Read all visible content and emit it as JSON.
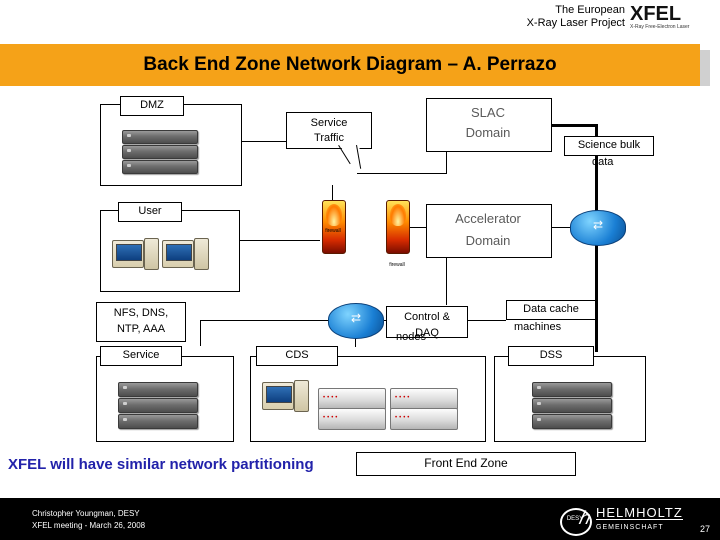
{
  "header": {
    "line1": "The European",
    "line2": "X-Ray Laser Project",
    "logo": "XFEL",
    "logo_sub": "X-Ray Free-Electron Laser"
  },
  "title": "Back End Zone Network Diagram – A. Perrazo",
  "diagram": {
    "boxes": [
      {
        "name": "dmz",
        "label": "DMZ"
      },
      {
        "name": "user",
        "label": "User"
      },
      {
        "name": "nfs-dns-ntp-aaa",
        "label": "NFS, DNS,\nNTP, AAA"
      },
      {
        "name": "service",
        "label": "Service"
      },
      {
        "name": "cds",
        "label": "CDS"
      },
      {
        "name": "dss",
        "label": "DSS"
      },
      {
        "name": "front-end-zone",
        "label": "Front End Zone"
      }
    ],
    "labels": {
      "dmz": "DMZ",
      "user": "User",
      "nfs_line1": "NFS, DNS,",
      "nfs_line2": "NTP, AAA",
      "service_box": "Service",
      "cds": "CDS",
      "dss": "DSS",
      "front_end_zone": "Front End Zone",
      "slac_domain_l1": "SLAC",
      "slac_domain_l2": "Domain",
      "accelerator_domain_l1": "Accelerator",
      "accelerator_domain_l2": "Domain",
      "science_bulk_l1": "Science bulk",
      "science_bulk_l2": "data",
      "control_daq_l1": "Control &",
      "control_daq_l2": "DAQ",
      "control_daq_l3": "nodes",
      "data_cache_l1": "Data cache",
      "data_cache_l2": "machines",
      "service_traffic_l1": "Service",
      "service_traffic_l2": "Traffic",
      "firewall_1": "firewall",
      "firewall_2": "firewall"
    }
  },
  "bottom_statement": "XFEL will have similar network partitioning",
  "footer": {
    "line1": "Christopher Youngman, DESY",
    "line2": "XFEL meeting  - March 26, 2008",
    "slide_number": "27",
    "desy": "DESY",
    "helmholtz_line1": "HELMHOLTZ",
    "helmholtz_line2": "GEMEINSCHAFT"
  }
}
